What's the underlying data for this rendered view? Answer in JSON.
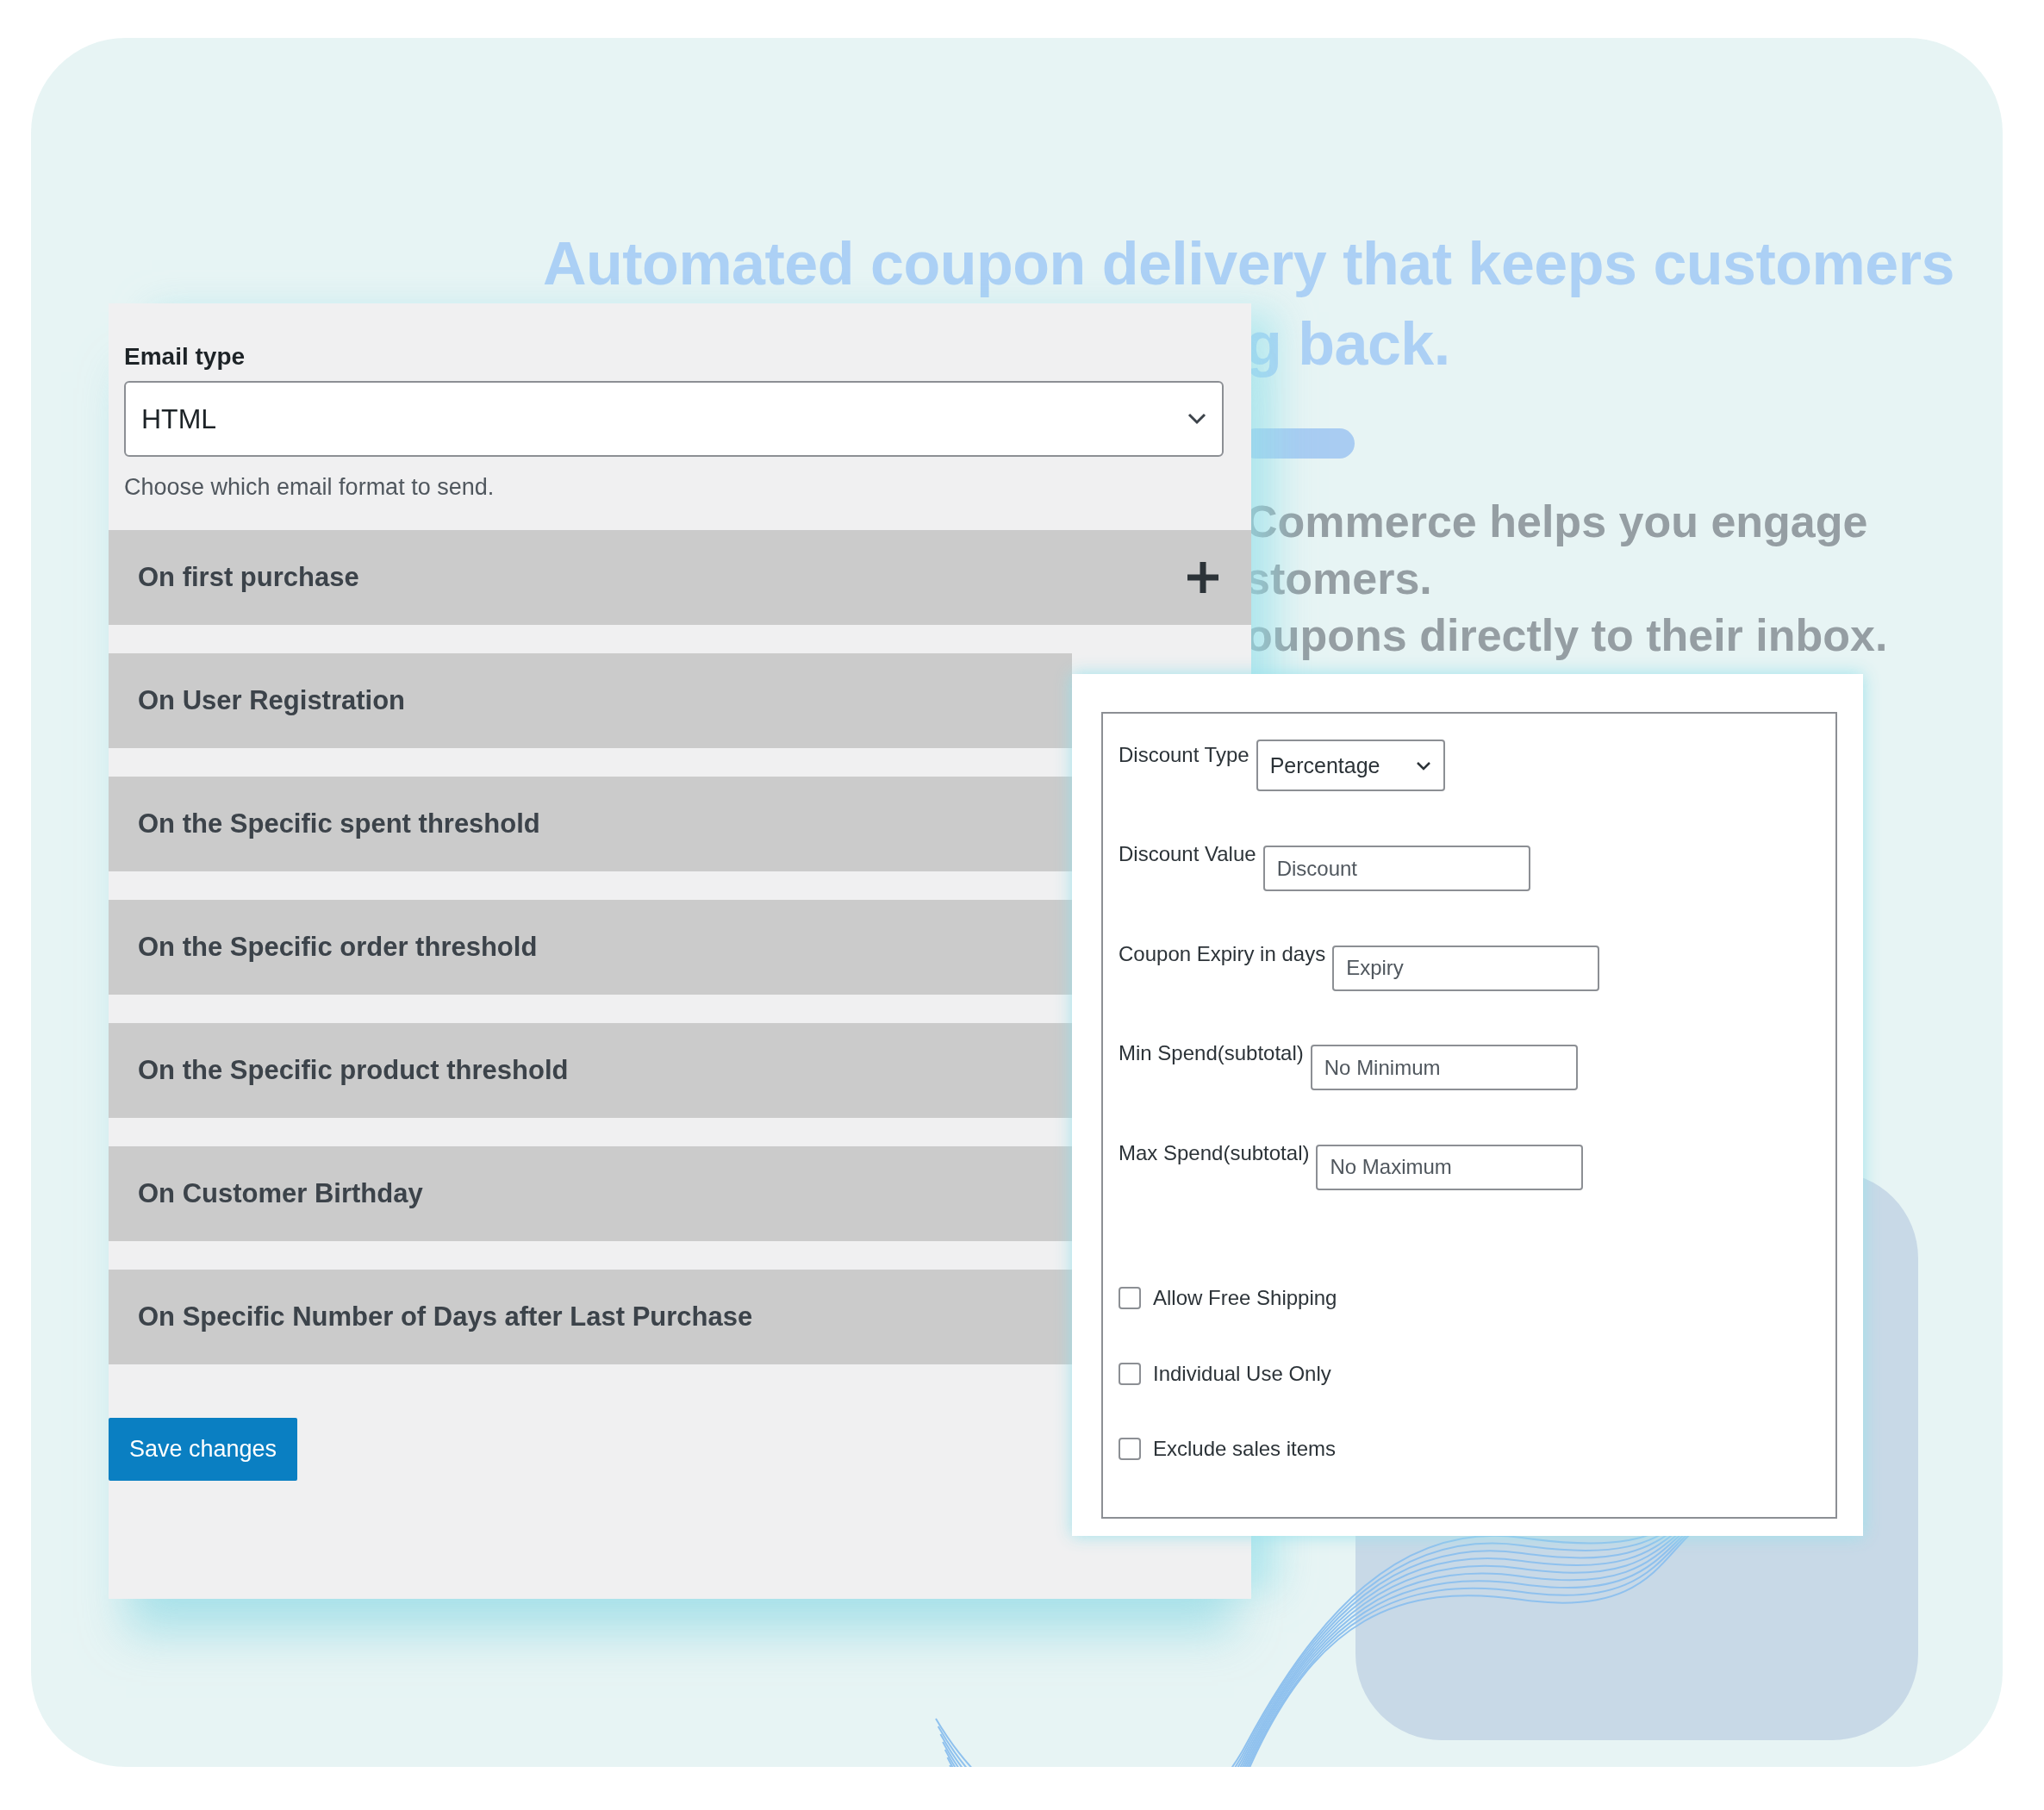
{
  "headline": {
    "line_1": "Automated coupon delivery that keeps customers",
    "line_2": "g back."
  },
  "description": [
    "Commerce helps you engage",
    "stomers.",
    "oupons directly to their inbox."
  ],
  "email_settings": {
    "label": "Email type",
    "select_value": "HTML",
    "hint": "Choose which email format to send.",
    "triggers": [
      {
        "label": "On first purchase",
        "toggle_shown": true
      },
      {
        "label": "On User Registration",
        "toggle_shown": false
      },
      {
        "label": "On the Specific spent threshold",
        "toggle_shown": false
      },
      {
        "label": "On the Specific order threshold",
        "toggle_shown": false
      },
      {
        "label": "On the Specific product threshold",
        "toggle_shown": false
      },
      {
        "label": "On Customer Birthday",
        "toggle_shown": false
      },
      {
        "label": "On Specific Number of Days after Last Purchase",
        "toggle_shown": false
      }
    ],
    "save_button": "Save changes"
  },
  "coupon_form": {
    "fields": [
      {
        "kind": "select",
        "label": "Discount Type",
        "value": "Percentage"
      },
      {
        "kind": "text",
        "label": "Discount Value",
        "placeholder": "Discount"
      },
      {
        "kind": "text",
        "label": "Coupon Expiry in days",
        "placeholder": "Expiry"
      },
      {
        "kind": "text",
        "label": "Min Spend(subtotal)",
        "placeholder": "No Minimum"
      },
      {
        "kind": "text",
        "label": "Max Spend(subtotal)",
        "placeholder": "No Maximum"
      }
    ],
    "options": [
      {
        "label": "Allow Free Shipping",
        "checked": false
      },
      {
        "label": "Individual Use Only",
        "checked": false
      },
      {
        "label": "Exclude sales items",
        "checked": false
      }
    ]
  }
}
